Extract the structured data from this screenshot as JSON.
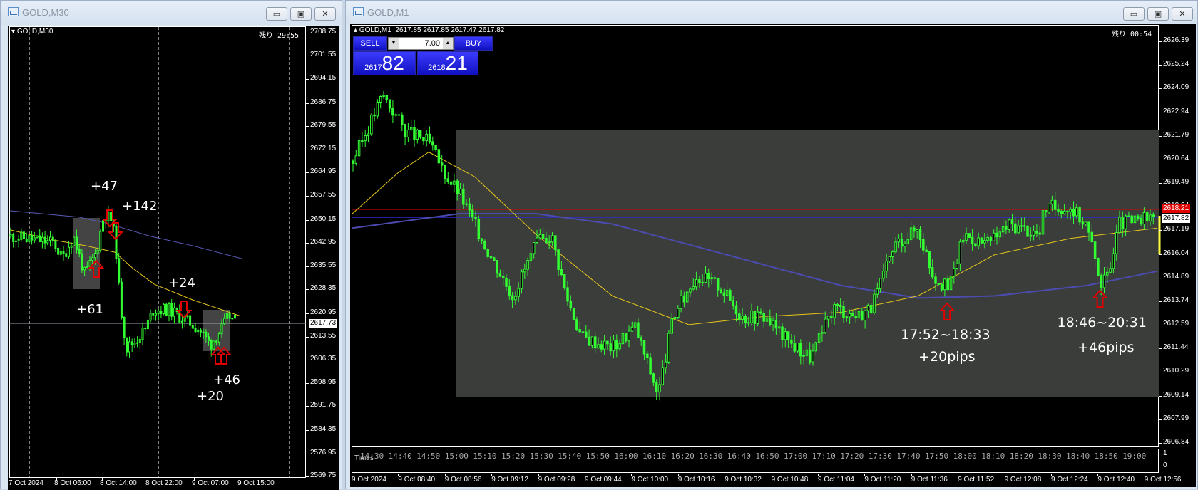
{
  "left_window": {
    "title": "GOLD,M30",
    "symbol_label": "GOLD,M30",
    "countdown": "残り 29:55",
    "price_axis": [
      "2708.75",
      "2701.55",
      "2694.15",
      "2686.75",
      "2679.55",
      "2672.15",
      "2664.95",
      "2657.55",
      "2650.15",
      "2642.95",
      "2635.55",
      "2628.35",
      "2620.95",
      "2613.55",
      "2606.35",
      "2598.95",
      "2591.75",
      "2584.35",
      "2576.95",
      "2569.75"
    ],
    "current_price": "2617.73",
    "date_axis": [
      "7 Oct 2024",
      "8 Oct 06:00",
      "8 Oct 14:00",
      "8 Oct 22:00",
      "9 Oct 07:00",
      "9 Oct 15:00"
    ],
    "annotations": [
      "+47",
      "+142",
      "+61",
      "+24",
      "+46",
      "+20"
    ]
  },
  "right_window": {
    "title": "GOLD,M1",
    "symbol_label": "GOLD,M1",
    "ohlc": "2617.85 2617.85 2617.47 2617.82",
    "countdown": "残り 00:54",
    "trade_panel": {
      "sell_label": "SELL",
      "buy_label": "BUY",
      "lot_value": "7.00",
      "sell_big": "2617",
      "sell_small": "82",
      "buy_big": "2618",
      "buy_small": "21"
    },
    "price_axis": [
      "2626.39",
      "2625.24",
      "2624.09",
      "2622.94",
      "2621.79",
      "2620.64",
      "2619.49",
      "2618.34",
      "2617.19",
      "2616.04",
      "2614.89",
      "2613.74",
      "2612.59",
      "2611.44",
      "2610.29",
      "2609.14",
      "2607.99",
      "2606.84"
    ],
    "ask_price": "2618.21",
    "bid_price": "2617.82",
    "times_label": "Times",
    "times_axis": [
      "14:30",
      "14:40",
      "14:50",
      "15:00",
      "15:10",
      "15:20",
      "15:30",
      "15:40",
      "15:50",
      "16:00",
      "16:10",
      "16:20",
      "16:30",
      "16:40",
      "16:50",
      "17:00",
      "17:10",
      "17:20",
      "17:30",
      "17:40",
      "17:50",
      "18:00",
      "18:10",
      "18:20",
      "18:30",
      "18:40",
      "18:50",
      "19:00"
    ],
    "sub_axis": [
      "1",
      "0"
    ],
    "date_axis": [
      "9 Oct 2024",
      "9 Oct 08:40",
      "9 Oct 08:56",
      "9 Oct 09:12",
      "9 Oct 09:28",
      "9 Oct 09:44",
      "9 Oct 10:00",
      "9 Oct 10:16",
      "9 Oct 10:32",
      "9 Oct 10:48",
      "9 Oct 11:04",
      "9 Oct 11:20",
      "9 Oct 11:36",
      "9 Oct 11:52",
      "9 Oct 12:08",
      "9 Oct 12:24",
      "9 Oct 12:40",
      "9 Oct 12:56"
    ],
    "annotations": {
      "trade1_time": "17:52~18:33",
      "trade1_pips": "+20pips",
      "trade2_time": "18:46~20:31",
      "trade2_pips": "+46pips"
    }
  },
  "window_buttons": {
    "minimize": "▭",
    "restore": "▣",
    "close": "✕"
  },
  "colors": {
    "bull": "#33ff33",
    "ma_fast": "#e6c619",
    "ma_slow": "#4b4bb0",
    "arrow": "#e00000",
    "ask": "#e00000",
    "bid": "#1a1aa0",
    "highlight": "#3a3d3a"
  }
}
